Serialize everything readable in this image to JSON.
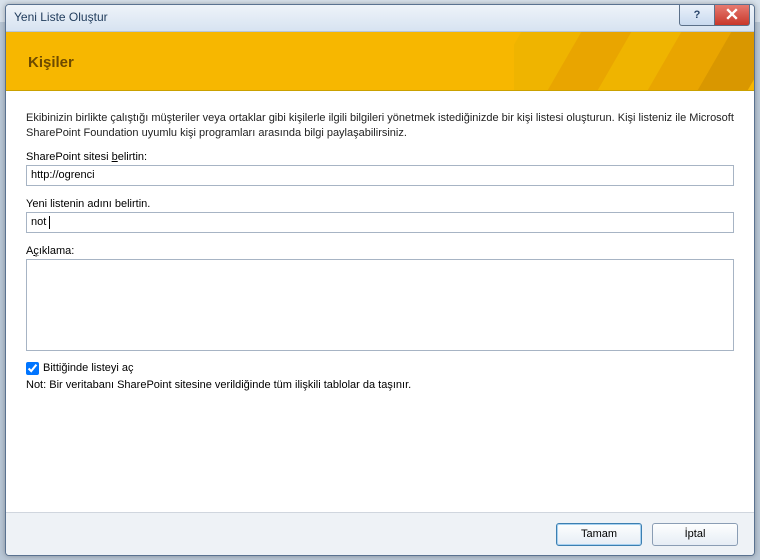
{
  "window": {
    "title": "Yeni Liste Oluştur"
  },
  "banner": {
    "title": "Kişiler"
  },
  "description": "Ekibinizin birlikte çalıştığı müşteriler veya ortaklar gibi kişilerle ilgili bilgileri yönetmek istediğinizde bir kişi listesi oluşturun. Kişi listeniz ile Microsoft SharePoint Foundation uyumlu kişi programları arasında bilgi paylaşabilirsiniz.",
  "fields": {
    "site": {
      "label_pre": "SharePoint sitesi ",
      "accel": "b",
      "label_post": "elirtin:",
      "value": "http://ogrenci"
    },
    "listname": {
      "label": "Yeni listenin adını belirtin.",
      "value": "not"
    },
    "desc": {
      "label_pre": "A",
      "accel": "ç",
      "label_post": "ıklama:",
      "value": ""
    }
  },
  "open_when_done": {
    "checked": true,
    "label_pre": "",
    "accel": "B",
    "label_post": "ittiğinde listeyi aç"
  },
  "note": "Not: Bir veritabanı SharePoint sitesine verildiğinde tüm ilişkili tablolar da taşınır.",
  "buttons": {
    "ok": "Tamam",
    "cancel": "İptal"
  },
  "titlebar_buttons": {
    "help": "?",
    "close": "✕"
  }
}
